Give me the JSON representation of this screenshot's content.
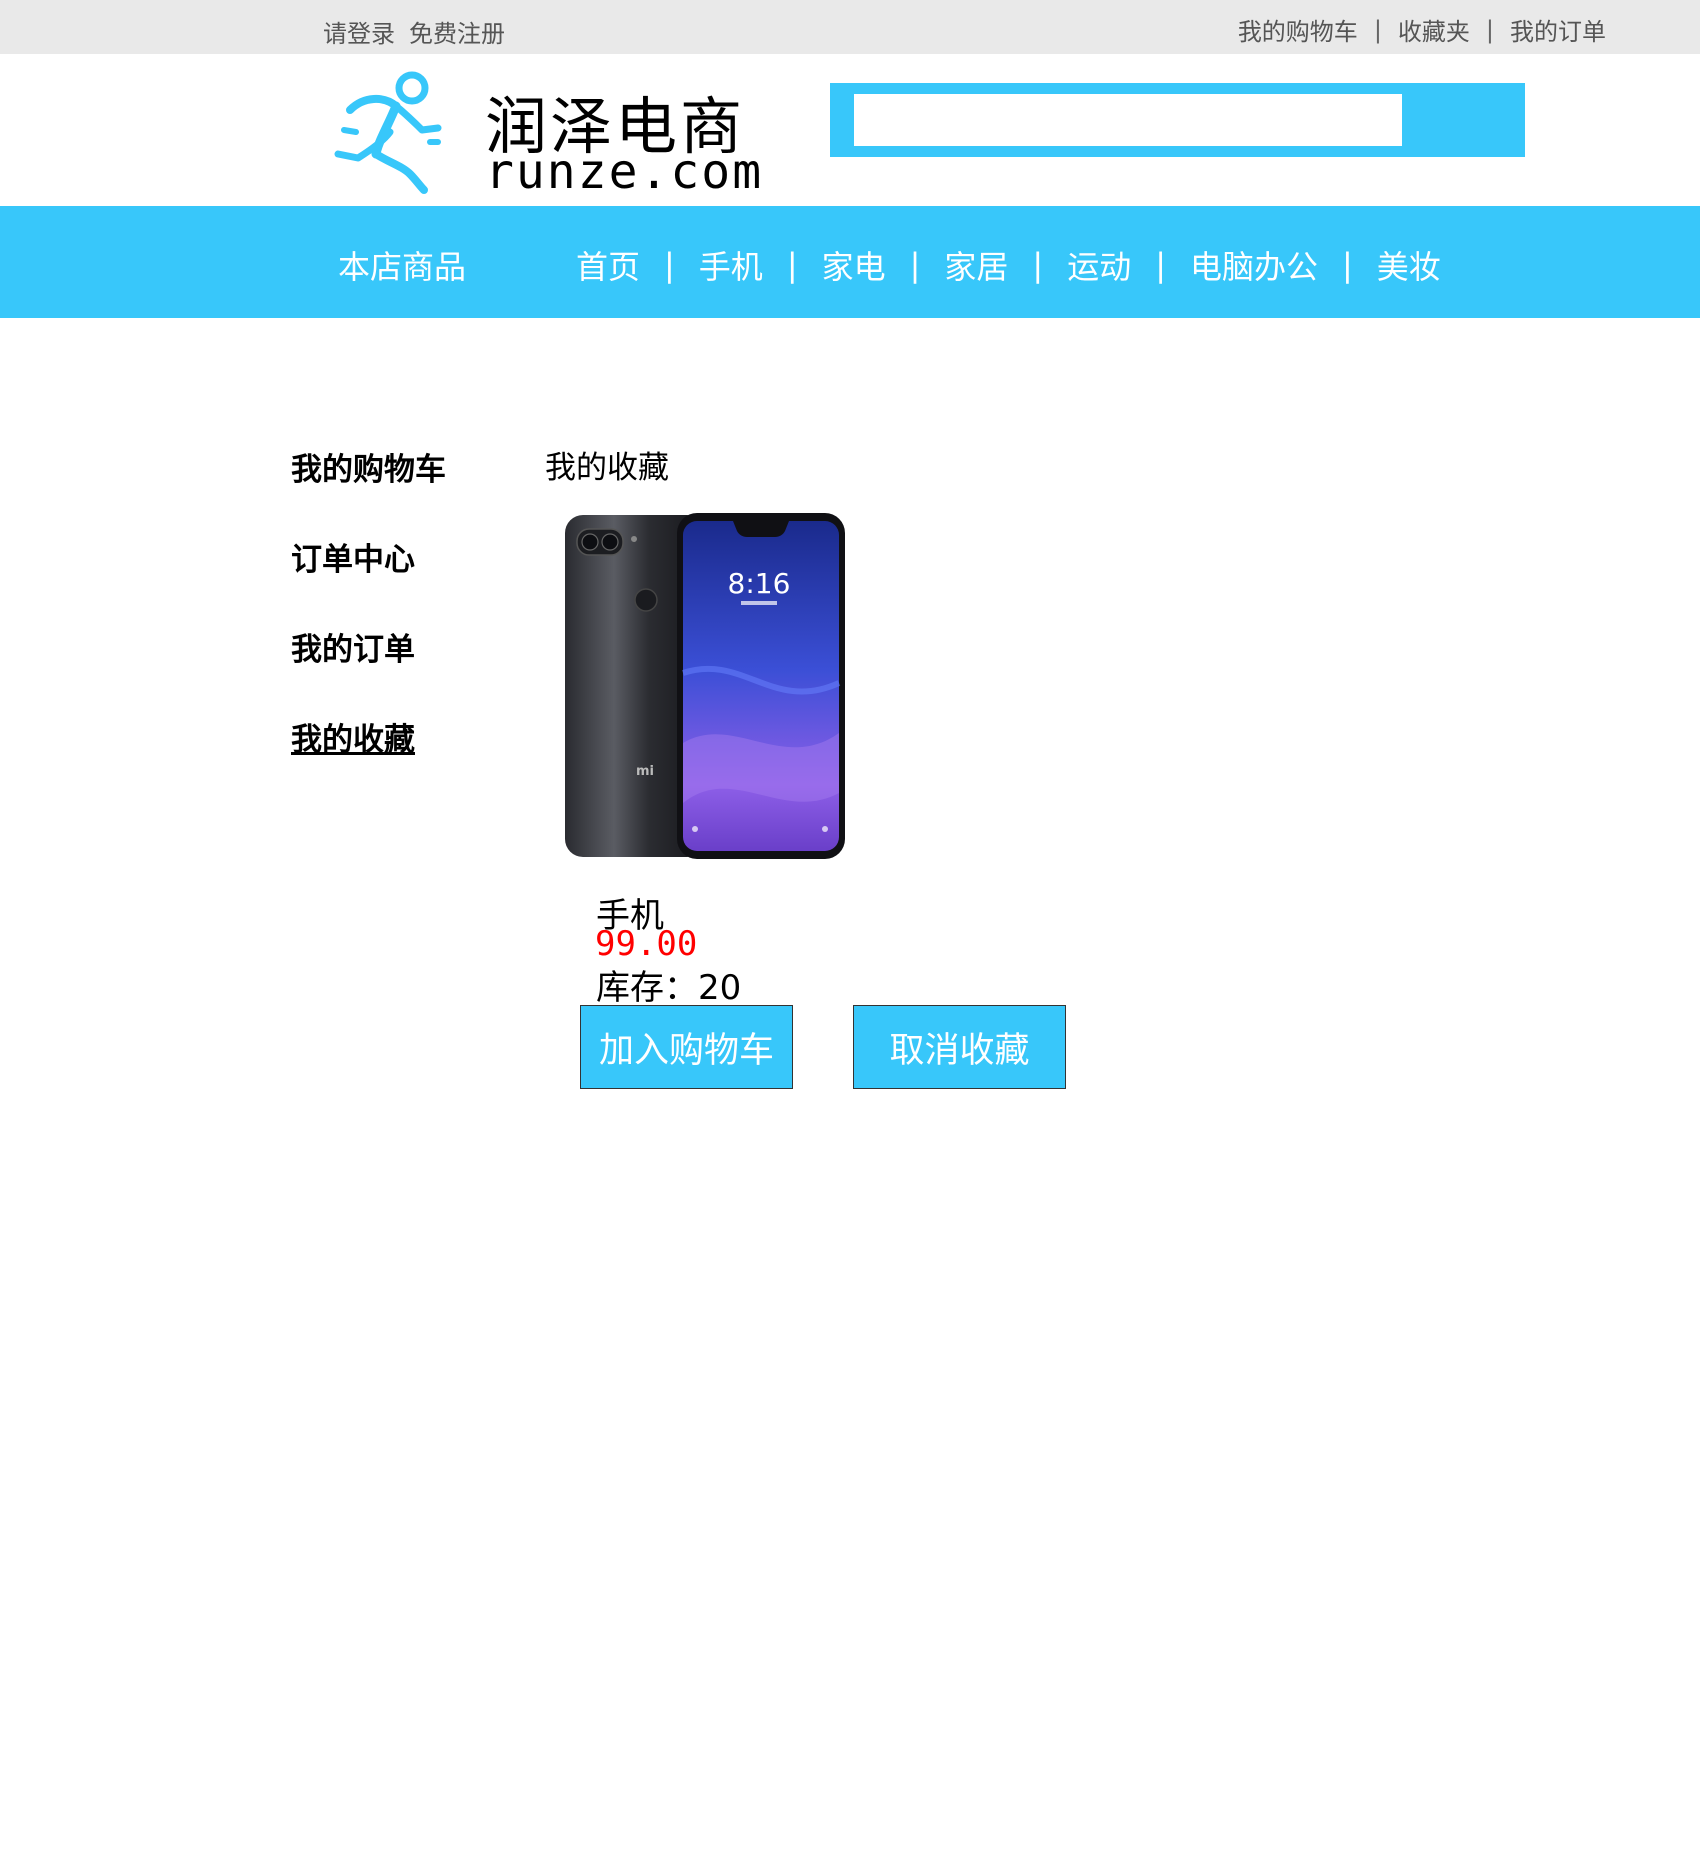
{
  "topbar": {
    "login": "请登录",
    "register": "免费注册",
    "cart": "我的购物车",
    "favorites": "收藏夹",
    "orders": "我的订单",
    "separator": "|"
  },
  "logo": {
    "name_cn": "润泽电商",
    "domain": "runze.com",
    "color": "#38c7fa"
  },
  "search": {
    "placeholder": "",
    "value": ""
  },
  "nav": {
    "store_label": "本店商品",
    "separator": "|",
    "links": [
      "首页",
      "手机",
      "家电",
      "家居",
      "运动",
      "电脑办公",
      "美妆"
    ],
    "background": "#38c7fa"
  },
  "sidebar": {
    "items": [
      "我的购物车",
      "订单中心",
      "我的订单",
      "我的收藏"
    ],
    "active": "我的收藏"
  },
  "main": {
    "title": "我的收藏",
    "product": {
      "image_icon": "phone-image",
      "name": "手机",
      "price": "99.00",
      "stock": "库存：20",
      "phone_time": "8:16",
      "phone_brand": "mi"
    },
    "buttons": {
      "add_to_cart": "加入购物车",
      "remove_favorite": "取消收藏"
    }
  }
}
